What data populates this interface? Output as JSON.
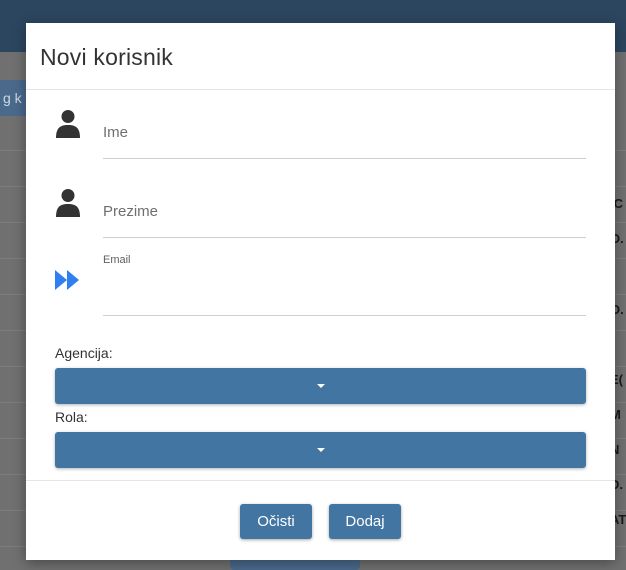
{
  "background": {
    "search_fragment": "g k",
    "row_fragments": [
      ".C",
      "O.",
      "O.",
      "E(",
      "M",
      "N",
      "D.",
      "AT"
    ]
  },
  "modal": {
    "title": "Novi korisnik",
    "fields": {
      "first_name": {
        "label": "Ime",
        "icon": "user-icon",
        "value": ""
      },
      "last_name": {
        "label": "Prezime",
        "icon": "user-icon",
        "value": ""
      },
      "email": {
        "label": "Email",
        "icon": "double-chevron-right-icon",
        "value": ""
      }
    },
    "agency": {
      "label": "Agencija:",
      "selected": ""
    },
    "role": {
      "label": "Rola:",
      "selected": ""
    },
    "buttons": {
      "clear": "Očisti",
      "add": "Dodaj"
    }
  },
  "colors": {
    "primary": "#4375a3",
    "header": "#2c4660",
    "icon_dark": "#333333",
    "icon_accent": "#2f7ff0"
  }
}
